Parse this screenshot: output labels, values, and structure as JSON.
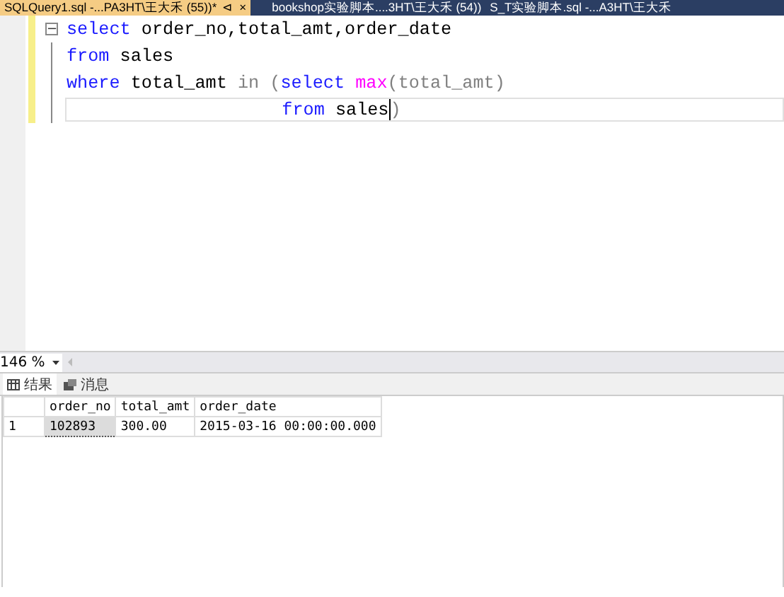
{
  "tabs": [
    {
      "label": "SQLQuery1.sql -...PA3HT\\王大禾 (55))*",
      "selected": true,
      "pin": "⊲",
      "close": "×"
    },
    {
      "label": "bookshop实验脚本....3HT\\王大禾 (54))",
      "selected": false
    },
    {
      "label": "S_T实验脚本.sql -...A3HT\\王大禾",
      "selected": false
    }
  ],
  "editor": {
    "lines": [
      {
        "current": false,
        "fold": "−",
        "tokens": [
          {
            "text": "select",
            "kind": "keyword"
          },
          {
            "text": " order_no,total_amt,order_date",
            "kind": "plain"
          }
        ]
      },
      {
        "current": false,
        "tokens": [
          {
            "text": "from",
            "kind": "keyword"
          },
          {
            "text": " sales",
            "kind": "plain"
          }
        ]
      },
      {
        "current": false,
        "tokens": [
          {
            "text": "where",
            "kind": "keyword"
          },
          {
            "text": " total_amt ",
            "kind": "plain"
          },
          {
            "text": "in",
            "kind": "operator"
          },
          {
            "text": " (",
            "kind": "operator"
          },
          {
            "text": "select",
            "kind": "keyword"
          },
          {
            "text": " max",
            "kind": "function"
          },
          {
            "text": "(total_amt)",
            "kind": "operator"
          }
        ]
      },
      {
        "current": true,
        "tokens": [
          {
            "text": "                    from",
            "kind": "keyword"
          },
          {
            "text": " sales",
            "kind": "plain"
          },
          {
            "text": ")",
            "kind": "operator"
          }
        ]
      }
    ]
  },
  "zoom": {
    "value": "146 %"
  },
  "result_tabs": [
    {
      "label": "结果",
      "selected": true
    },
    {
      "label": "消息",
      "selected": false
    }
  ],
  "grid": {
    "columns": [
      "order_no",
      "total_amt",
      "order_date"
    ],
    "rows": [
      {
        "number": "1",
        "cells": [
          "102893",
          "300.00",
          "2015-03-16 00:00:00.000"
        ]
      }
    ]
  }
}
